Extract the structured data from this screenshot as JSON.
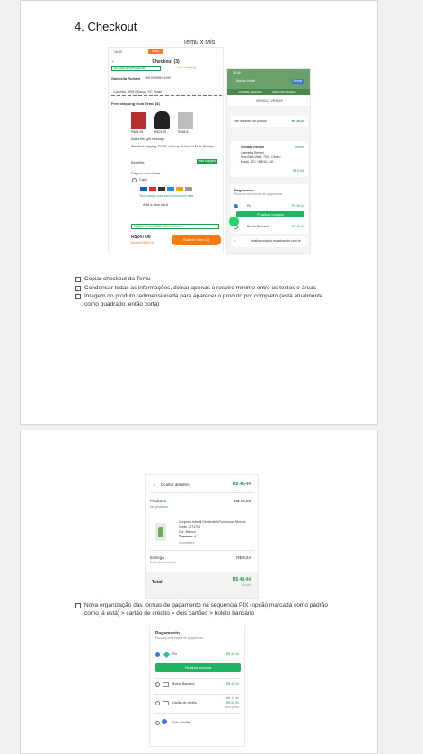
{
  "page1": {
    "heading": "4. Checkout",
    "caption": "Temu x Mis",
    "temu": {
      "time": "16:50",
      "brand": "TEMU",
      "title": "Checkout (3)",
      "ship_badge": "All data is safeguarded",
      "free_ship": "Free shipping",
      "address_name": "Gabriella Roriani",
      "address_phone": "+55 979999 01190",
      "address_line": "Colombo, 80013 Sasua, SC, Brazil",
      "section_title": "Free shipping from Temu (3)",
      "prices": [
        "R$65,95",
        "R$23,75",
        "R$48,83"
      ],
      "gift": "Add a free gift message",
      "delivery": "Standard shipping: FREE, delivery: Arrives in 28 to 34 days",
      "benefits": "Benefits",
      "benefit_badge": "Free shipping",
      "payment_methods": "Payment methods",
      "card_label": "Card",
      "card_note": "Temu keeps your card information safe",
      "add_card": "Add a new card",
      "eligible": "Eligible to use R$50 off in all items",
      "total": "R$247,06",
      "total_sub": "Applied R$29 off",
      "submit": "Submit order (3)"
    },
    "mis": {
      "time": "18:58",
      "store": "Mundo Verde",
      "login": "Entrar",
      "bar_left": "COMPRA SEGURA",
      "bar_right": "100% PROTEGIDO",
      "logo": "MUNDO VERDE",
      "details_label": "Ver detalhes do pedido",
      "details_price": "R$ 49,44",
      "contact_title": "Contato Renani",
      "contact_action": "Alterar",
      "contact_lines": [
        "Gabriella Renani",
        "Rua Bela Vista, 700 - Centro",
        "Brasil - SC / 88010-100"
      ],
      "delivery_price": "R$ 9,64",
      "payment_title": "Pagamento",
      "payment_sub": "Escolha uma forma de pagamento",
      "pix": "Pix",
      "pix_price": "R$ 49,44",
      "finalize": "Finalizar compra",
      "boleto": "Boleto Bancario",
      "boleto_price": "R$ 49,44",
      "url": "finalizarcompra.mundoverde.com.br"
    },
    "checklist": [
      "Copiar checkout da Temu",
      "Condensar todas as informações, deixar apenas o respiro mínimo entre os textos e áreas",
      "Imagem do produto redimensionada para aparecer o produto por completo (está atualmente como quadrado, então corta)"
    ]
  },
  "page2": {
    "summary": {
      "hide_details": "Ocultar detalhes",
      "hide_price": "R$ 49,44",
      "products_label": "Produtos",
      "products_price": "R$ 39,80",
      "see_products": "Ver produtos",
      "product_name": "Conjunto Infantil Dinobrotinh/Formosura Menino Verde - 271754",
      "product_color": "Cor: Branco",
      "product_size": "Tamanho: 4",
      "product_qty": "2 unidades",
      "delivery_label": "Entrega",
      "delivery_sub": "Frete (Econômico)",
      "delivery_price": "R$ 9,64",
      "total_label": "Total:",
      "total_price": "R$ 49,44",
      "total_sub": "no pix"
    },
    "checklist": [
      "Nova organização das formas de pagamento na sequência PIX (opção marcada como padrão como já está) > cartão de crédito > dois cartões > boleto bancário"
    ],
    "payment": {
      "title": "Pagamento",
      "sub": "Escolha uma forma de pagamento",
      "pix": "Pix",
      "pix_price": "R$ 49,44",
      "finalize": "Finalizar compra",
      "boleto": "Boleto Bancário",
      "boleto_price": "R$ 49,44",
      "card": "Cartão de crédito",
      "card_price_top": "até 1x de",
      "card_price": "R$ 52,94",
      "card_price_sub": "sem juros",
      "two_cards": "Dois Cartões"
    }
  },
  "colors": {
    "green": "#20b363",
    "orange": "#f57a0f",
    "mis_header": "#6aa06a"
  }
}
